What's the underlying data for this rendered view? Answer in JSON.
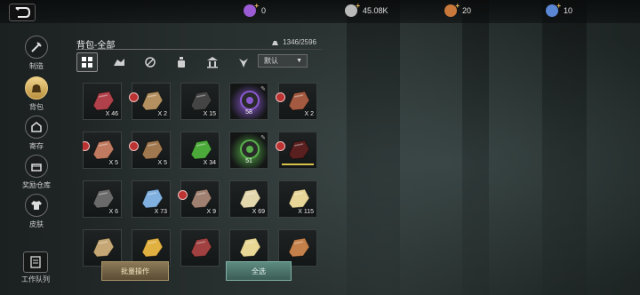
{
  "currencies": [
    {
      "icon": "purple-gem-icon",
      "value": "0",
      "color": "#9a5bd4"
    },
    {
      "icon": "silver-coin-icon",
      "value": "45.08K",
      "color": "#b9b9b9"
    },
    {
      "icon": "bronze-token-icon",
      "value": "20",
      "color": "#c9783c"
    },
    {
      "icon": "blue-shard-icon",
      "value": "10",
      "color": "#5b86d4"
    }
  ],
  "sidebar": {
    "items": [
      {
        "label": "制造",
        "icon": "crafting-icon"
      },
      {
        "label": "背包",
        "icon": "bag-icon"
      },
      {
        "label": "寄存",
        "icon": "storage-icon"
      },
      {
        "label": "奖励仓库",
        "icon": "reward-chest-icon"
      },
      {
        "label": "皮肤",
        "icon": "skin-shirt-icon"
      }
    ],
    "worklist_label": "工作队列"
  },
  "panel": {
    "title": "背包-全部",
    "capacity": "1346/2596",
    "sort_label": "默认",
    "filters": [
      "all-filter-icon",
      "material-filter-icon",
      "fiber-filter-icon",
      "potion-filter-icon",
      "building-filter-icon",
      "gear-filter-icon"
    ]
  },
  "items": [
    {
      "name": "meat",
      "qty": "X 46",
      "color": "#b0404a"
    },
    {
      "name": "wood-logs",
      "qty": "X 2",
      "color": "#b49060",
      "locked": true
    },
    {
      "name": "berries",
      "qty": "X 15",
      "color": "#444"
    },
    {
      "name": "creature-core-purple",
      "qty": "58",
      "color": "#8a5ad0",
      "core": true
    },
    {
      "name": "sausage",
      "qty": "X 2",
      "color": "#a45a40",
      "locked": true
    },
    {
      "name": "hardwood-logs",
      "qty": "X 5",
      "color": "#c07a60",
      "locked": true
    },
    {
      "name": "wood-planks",
      "qty": "X 5",
      "color": "#a0784f",
      "locked": true
    },
    {
      "name": "herbs",
      "qty": "X 34",
      "color": "#4caa3a"
    },
    {
      "name": "creature-core-green",
      "qty": "51",
      "color": "#57b04a",
      "core": true
    },
    {
      "name": "dark-feather",
      "qty": "",
      "color": "#5a1f1f",
      "locked": true,
      "bar": true
    },
    {
      "name": "coal",
      "qty": "X 6",
      "color": "#6a6a6a"
    },
    {
      "name": "crystal",
      "qty": "X 73",
      "color": "#7fb0e0"
    },
    {
      "name": "feather",
      "qty": "X 9",
      "color": "#a08070",
      "locked": true
    },
    {
      "name": "bone",
      "qty": "X 69",
      "color": "#e3d7ad"
    },
    {
      "name": "grain",
      "qty": "X 115",
      "color": "#e8d598"
    },
    {
      "name": "pelt-bundle",
      "qty": "",
      "color": "#c4a774"
    },
    {
      "name": "gold-bar",
      "qty": "",
      "color": "#e0b040"
    },
    {
      "name": "meat-dish",
      "qty": "",
      "color": "#a04040"
    },
    {
      "name": "paper",
      "qty": "",
      "color": "#e9d795"
    },
    {
      "name": "sack",
      "qty": "",
      "color": "#c4804a"
    }
  ],
  "buttons": {
    "batch": "批量操作",
    "select_all": "全选"
  }
}
